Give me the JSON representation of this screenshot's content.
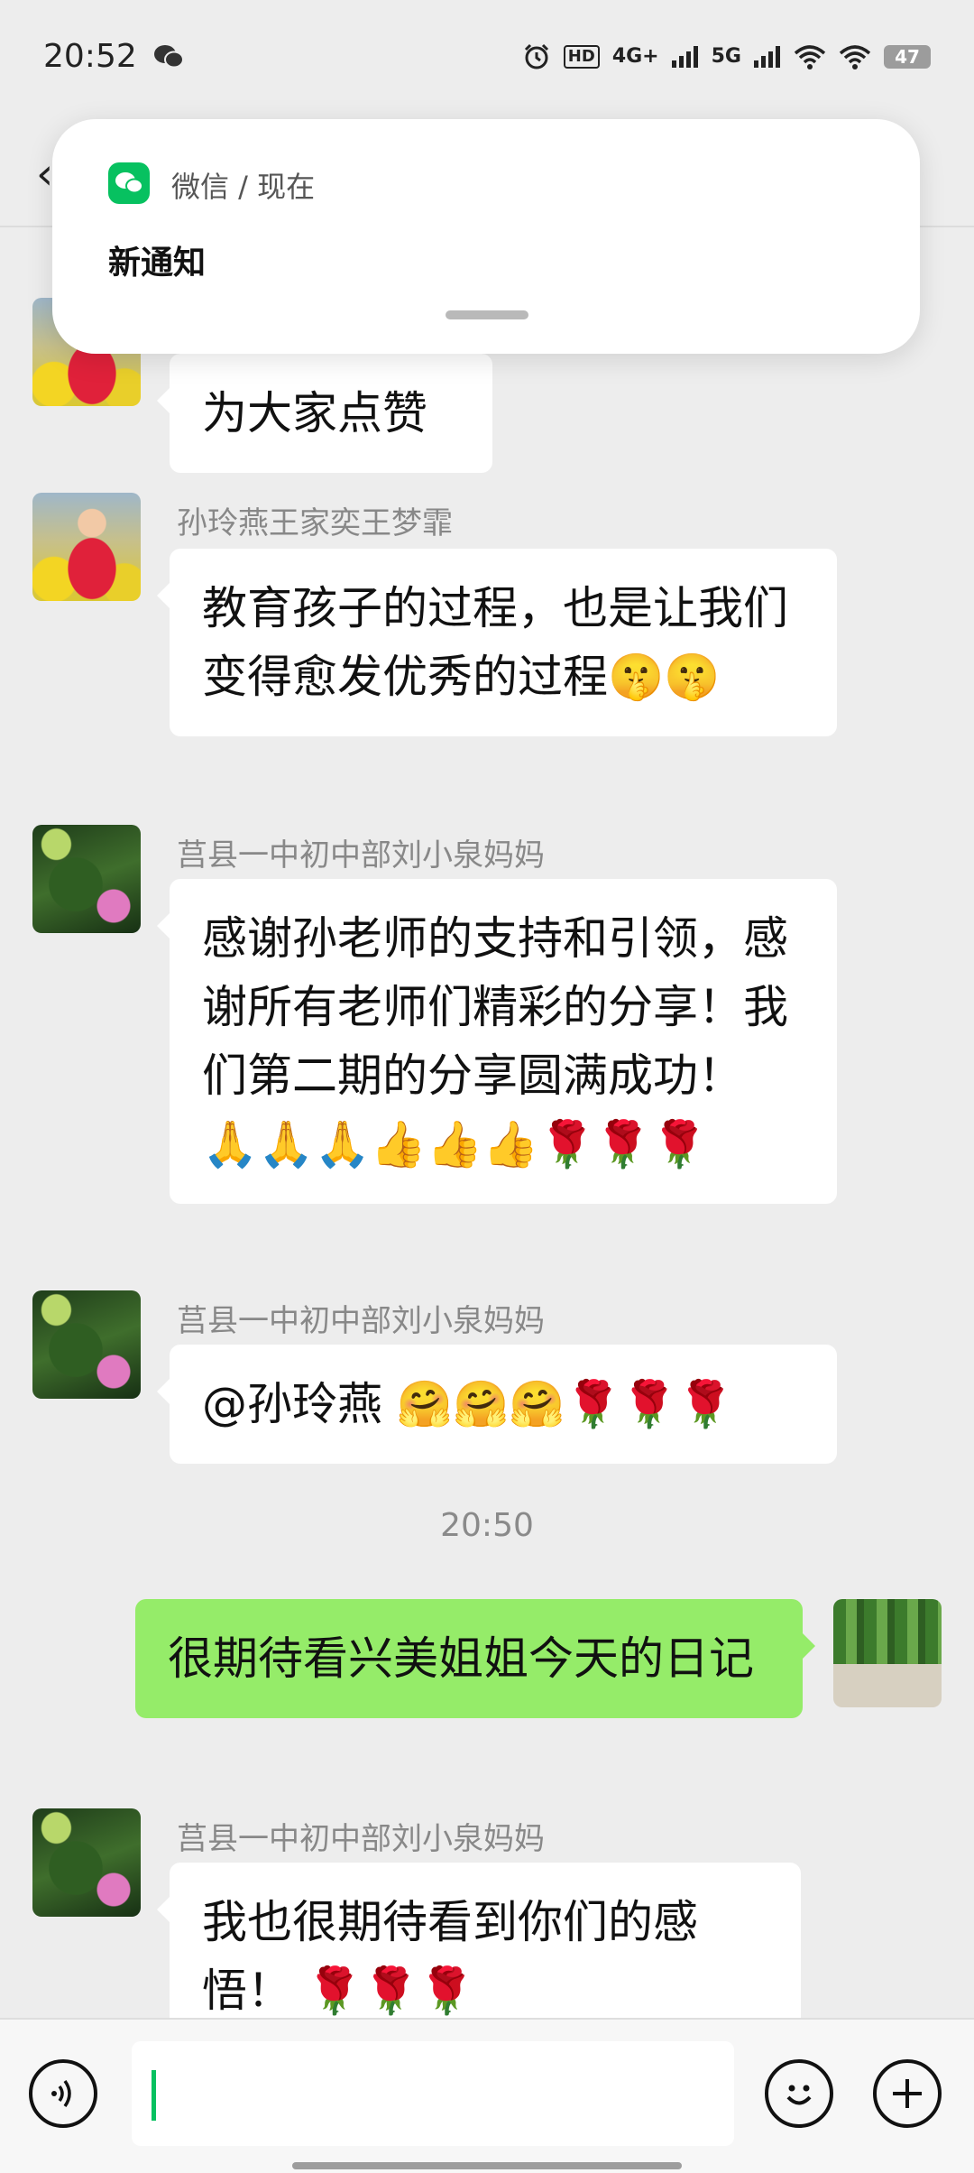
{
  "status_bar": {
    "time": "20:52",
    "hd_label": "HD",
    "net1": "4G+",
    "net2": "5G",
    "battery": "47"
  },
  "notification": {
    "app_source": "微信 / 现在",
    "title": "新通知"
  },
  "messages": [
    {
      "sender": "",
      "text": "为大家点赞",
      "side": "left",
      "avatar": "lady-in-flowers"
    },
    {
      "sender": "孙玲燕王家奕王梦霏",
      "text": "教育孩子的过程，也是让我们变得愈发优秀的过程🤫🤫",
      "side": "left",
      "avatar": "lady-in-flowers"
    },
    {
      "sender": "莒县一中初中部刘小泉妈妈",
      "text": "感谢孙老师的支持和引领，感谢所有老师们精彩的分享！我们第二期的分享圆满成功！ 🙏🙏🙏👍👍👍🌹🌹🌹",
      "side": "left",
      "avatar": "lotus"
    },
    {
      "sender": "莒县一中初中部刘小泉妈妈",
      "text": "@孙玲燕  🤗🤗🤗🌹🌹🌹",
      "side": "left",
      "avatar": "lotus"
    },
    {
      "sender": "",
      "text": "很期待看兴美姐姐今天的日记",
      "side": "right",
      "avatar": "trees"
    },
    {
      "sender": "莒县一中初中部刘小泉妈妈",
      "text": "我也很期待看到你们的感悟！ 🌹🌹🌹",
      "side": "left",
      "avatar": "lotus"
    }
  ],
  "timestamp": "20:50",
  "colors": {
    "background": "#ededed",
    "my_bubble": "#95ec69",
    "their_bubble": "#ffffff",
    "wechat_green": "#07c160"
  },
  "input_bar": {
    "voice_icon": "voice-icon",
    "emoji_icon": "emoji-icon",
    "plus_icon": "plus-icon",
    "value": ""
  }
}
